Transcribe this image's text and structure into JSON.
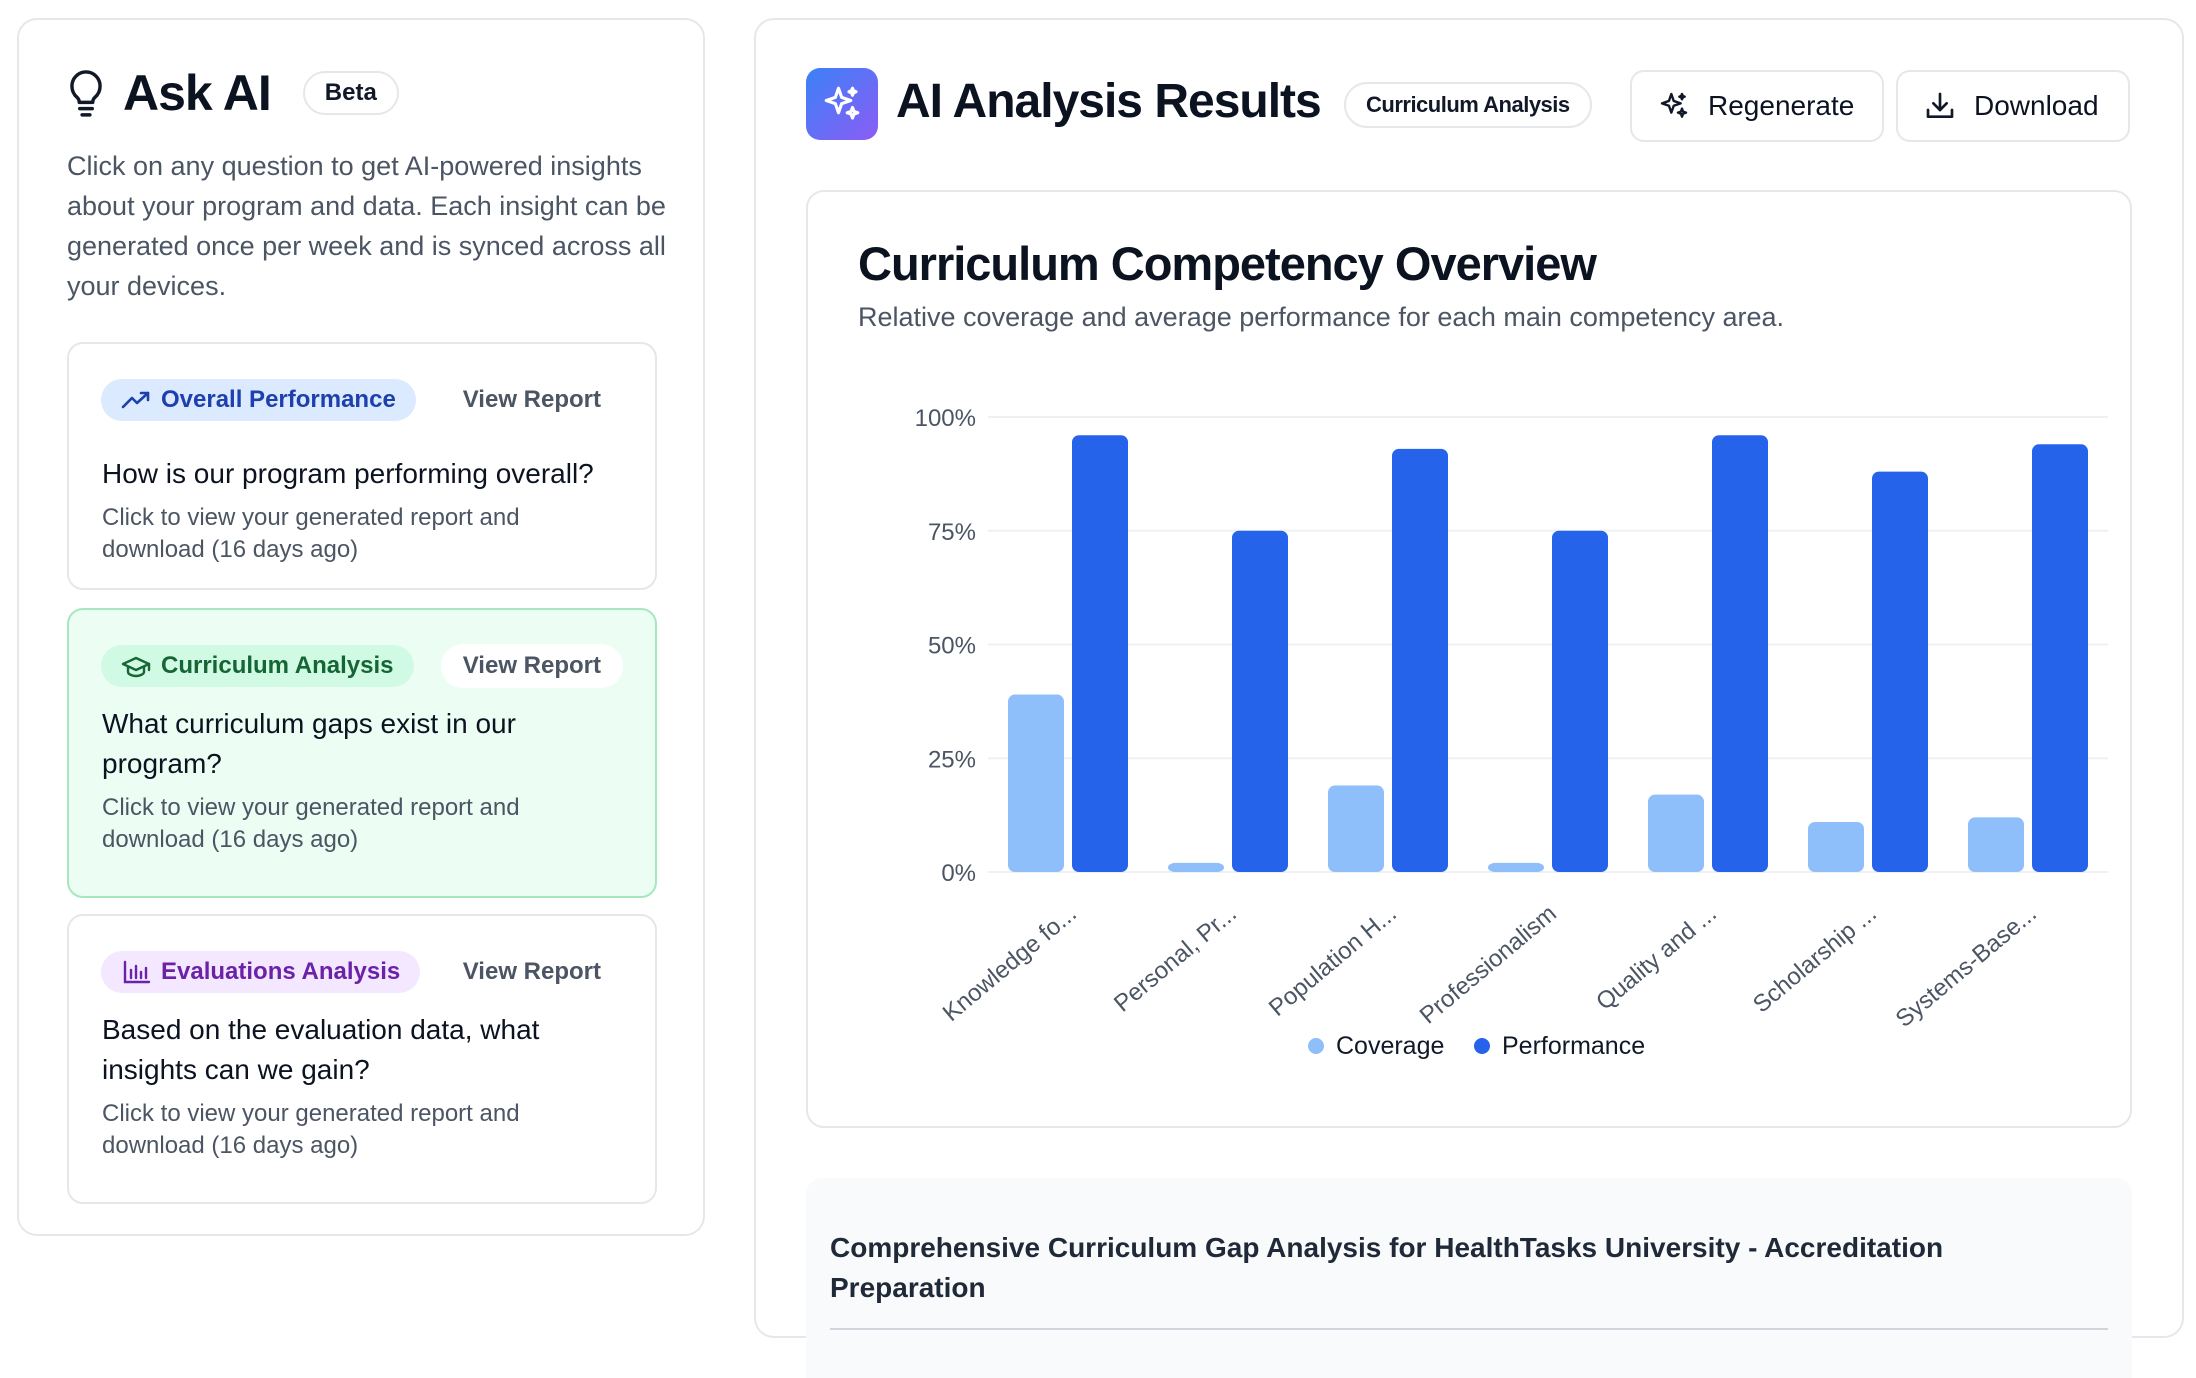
{
  "ask_ai": {
    "title": "Ask AI",
    "badge": "Beta",
    "description": "Click on any question to get AI-powered insights about your program and data. Each insight can be generated once per week and is synced across all your devices.",
    "cards": [
      {
        "tag": "Overall Performance",
        "tag_icon": "trending-up-icon",
        "action": "View Report",
        "question": "How is our program performing overall?",
        "subtext": "Click to view your generated report and download (16 days ago)"
      },
      {
        "tag": "Curriculum Analysis",
        "tag_icon": "graduation-cap-icon",
        "action": "View Report",
        "question": "What curriculum gaps exist in our program?",
        "subtext": "Click to view your generated report and download (16 days ago)"
      },
      {
        "tag": "Evaluations Analysis",
        "tag_icon": "bar-chart-icon",
        "action": "View Report",
        "question": "Based on the evaluation data, what insights can we gain?",
        "subtext": "Click to view your generated report and download (16 days ago)"
      }
    ]
  },
  "results": {
    "title": "AI Analysis Results",
    "badge": "Curriculum Analysis",
    "regenerate_label": "Regenerate",
    "download_label": "Download",
    "summary_title": "Comprehensive Curriculum Gap Analysis for HealthTasks University - Accreditation Preparation"
  },
  "chart_data": {
    "type": "bar",
    "title": "Curriculum Competency Overview",
    "subtitle": "Relative coverage and average performance for each main competency area.",
    "categories": [
      "Knowledge fo...",
      "Personal, Pr...",
      "Population H...",
      "Professionalism",
      "Quality and ...",
      "Scholarship ...",
      "Systems-Base..."
    ],
    "series": [
      {
        "name": "Coverage",
        "color": "#8fbffa",
        "values": [
          39,
          2,
          19,
          2,
          17,
          11,
          12
        ]
      },
      {
        "name": "Performance",
        "color": "#2563eb",
        "values": [
          96,
          75,
          93,
          75,
          96,
          88,
          94
        ]
      }
    ],
    "yticks": [
      "0%",
      "25%",
      "50%",
      "75%",
      "100%"
    ],
    "ylim": [
      0,
      100
    ],
    "legend_position": "bottom-center",
    "grid": true
  },
  "colors": {
    "accent": "#2563eb",
    "active_card_bg": "#ecfdf3"
  }
}
